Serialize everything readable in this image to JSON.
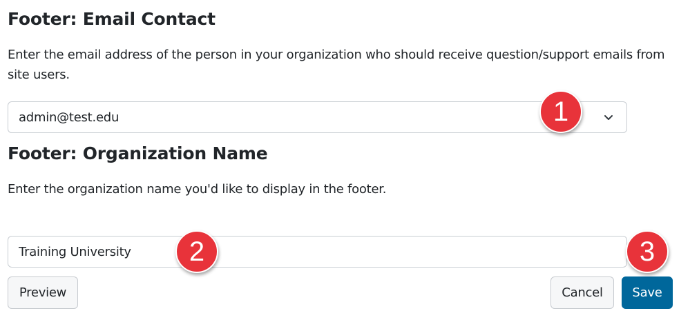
{
  "email_section": {
    "heading": "Footer: Email Contact",
    "description": "Enter the email address of the person in your organization who should receive question/support emails from site users.",
    "selected_value": "admin@test.edu"
  },
  "org_section": {
    "heading": "Footer: Organization Name",
    "description": "Enter the organization name you'd like to display in the footer.",
    "input_value": "Training University"
  },
  "callouts": [
    "1",
    "2",
    "3"
  ],
  "buttons": {
    "preview": "Preview",
    "cancel": "Cancel",
    "save": "Save"
  },
  "colors": {
    "primary": "#00679b",
    "callout": "#e8333a",
    "text": "#212529"
  },
  "icons": {
    "select_chevron": "chevron-down-icon"
  }
}
